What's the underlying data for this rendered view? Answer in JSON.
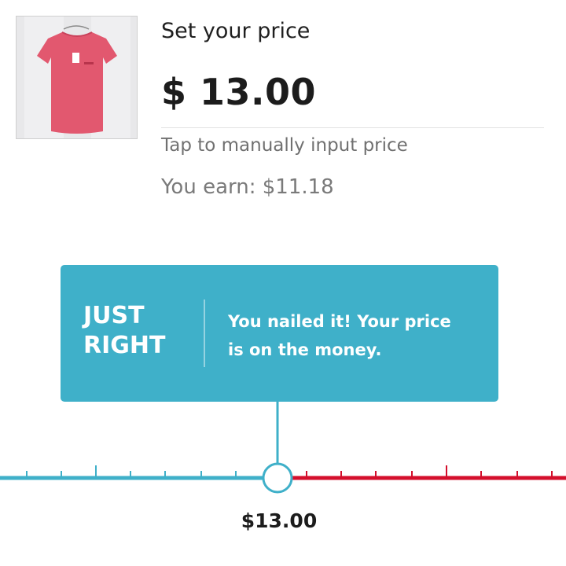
{
  "header": {
    "title": "Set your price",
    "price_display": "$ 13.00",
    "tap_hint": "Tap to manually input price",
    "earnings": "You earn: $11.18"
  },
  "item_image": {
    "icon": "pink-tshirt-photo"
  },
  "feedback": {
    "status_line1": "JUST",
    "status_line2": "RIGHT",
    "message_line1": "You nailed it! Your price",
    "message_line2": "is on the money.",
    "color": "#3fb0c9"
  },
  "slider": {
    "selected_label": "$13.00",
    "low_color": "#3fb0c9",
    "high_color": "#d40f2c"
  }
}
